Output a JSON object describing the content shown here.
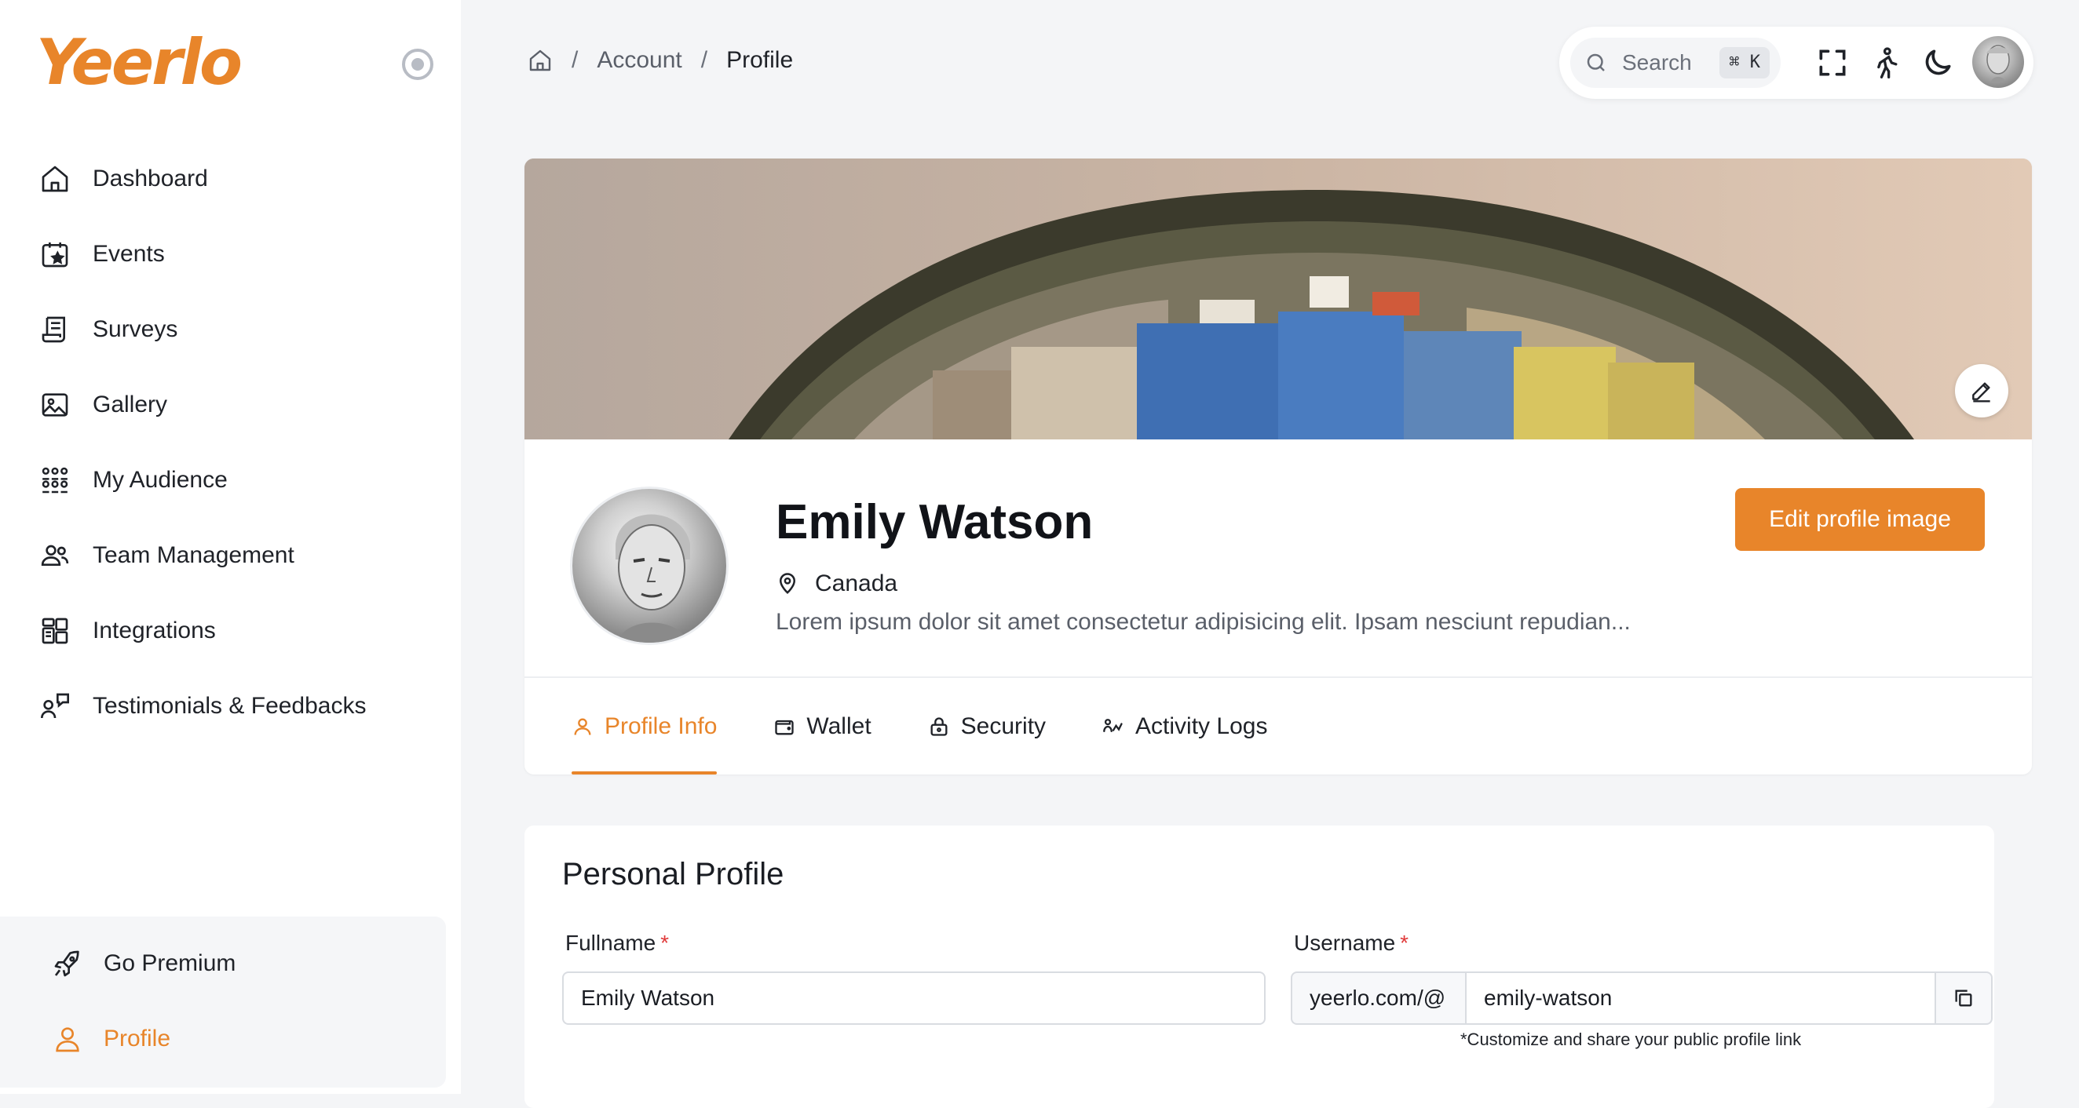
{
  "brand": {
    "logo_text": "Yeerlo",
    "accent": "#e8852a"
  },
  "sidebar": {
    "items": [
      {
        "label": "Dashboard",
        "icon": "home-icon"
      },
      {
        "label": "Events",
        "icon": "calendar-star-icon"
      },
      {
        "label": "Surveys",
        "icon": "survey-scroll-icon"
      },
      {
        "label": "Gallery",
        "icon": "gallery-icon"
      },
      {
        "label": "My Audience",
        "icon": "audience-icon"
      },
      {
        "label": "Team Management",
        "icon": "team-icon"
      },
      {
        "label": "Integrations",
        "icon": "integrations-icon"
      },
      {
        "label": "Testimonials & Feedbacks",
        "icon": "feedback-icon"
      }
    ],
    "bottom": {
      "premium_label": "Go Premium",
      "profile_label": "Profile"
    }
  },
  "breadcrumb": {
    "sep": "/",
    "account": "Account",
    "current": "Profile"
  },
  "topbar": {
    "search_placeholder": "Search",
    "shortcut": "⌘ K"
  },
  "profile": {
    "name": "Emily Watson",
    "location": "Canada",
    "bio": "Lorem ipsum dolor sit amet consectetur adipisicing elit. Ipsam nesciunt repudian...",
    "edit_image_label": "Edit profile image"
  },
  "tabs": [
    {
      "label": "Profile Info",
      "active": true
    },
    {
      "label": "Wallet",
      "active": false
    },
    {
      "label": "Security",
      "active": false
    },
    {
      "label": "Activity Logs",
      "active": false
    }
  ],
  "form": {
    "title": "Personal Profile",
    "fullname_label": "Fullname",
    "fullname_value": "Emily Watson",
    "username_label": "Username",
    "required_mark": "*",
    "username_prefix": "yeerlo.com/@",
    "username_value": "emily-watson",
    "username_hint": "*Customize and share your public profile link"
  }
}
